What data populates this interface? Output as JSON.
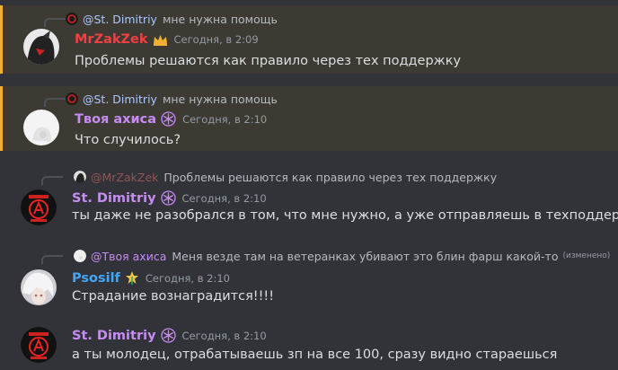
{
  "colors": {
    "background": "#313338",
    "mention_background": "#3c3a33",
    "mention_bar": "#f0b132",
    "red_author": "#f23f42",
    "purple_author": "#c78bf4",
    "blue_author": "#3fa7ff"
  },
  "messages": [
    {
      "reply": {
        "author": "@St. Dimitriy",
        "text": "мне нужна помощь"
      },
      "author": "MrZakZek",
      "badge_icon": "crown-icon",
      "time": "Сегодня, в 2:09",
      "text": "Проблемы решаются как правило через тех поддержку"
    },
    {
      "reply": {
        "author": "@St. Dimitriy",
        "text": "мне нужна помощь"
      },
      "author": "Твоя ахиса",
      "badge_icon": "snowflake-badge-icon",
      "time": "Сегодня, в 2:10",
      "text": "Что случилось?"
    },
    {
      "reply": {
        "author": "@MrZakZek",
        "text": "Проблемы решаются как правило через тех поддержку"
      },
      "author": "St. Dimitriy",
      "badge_icon": "snowflake-badge-icon",
      "time": "Сегодня, в 2:10",
      "text": "ты даже не разобрался в том, что мне нужно, а уже отправляешь в техподдержку"
    },
    {
      "reply": {
        "author": "@Твоя ахиса",
        "text": "Меня везде там на ветеранках убивают это блин фарш какой-то",
        "edited": "(изменено)"
      },
      "author": "Psosilf",
      "badge_icon": "leaf-badge-icon",
      "time": "Сегодня, в 2:10",
      "text": "Страдание вознаградится!!!!"
    },
    {
      "author": "St. Dimitriy",
      "badge_icon": "snowflake-badge-icon",
      "time": "Сегодня, в 2:10",
      "text": "а ты молодец, отрабатываешь зп на все 100, сразу видно стараешься"
    }
  ]
}
